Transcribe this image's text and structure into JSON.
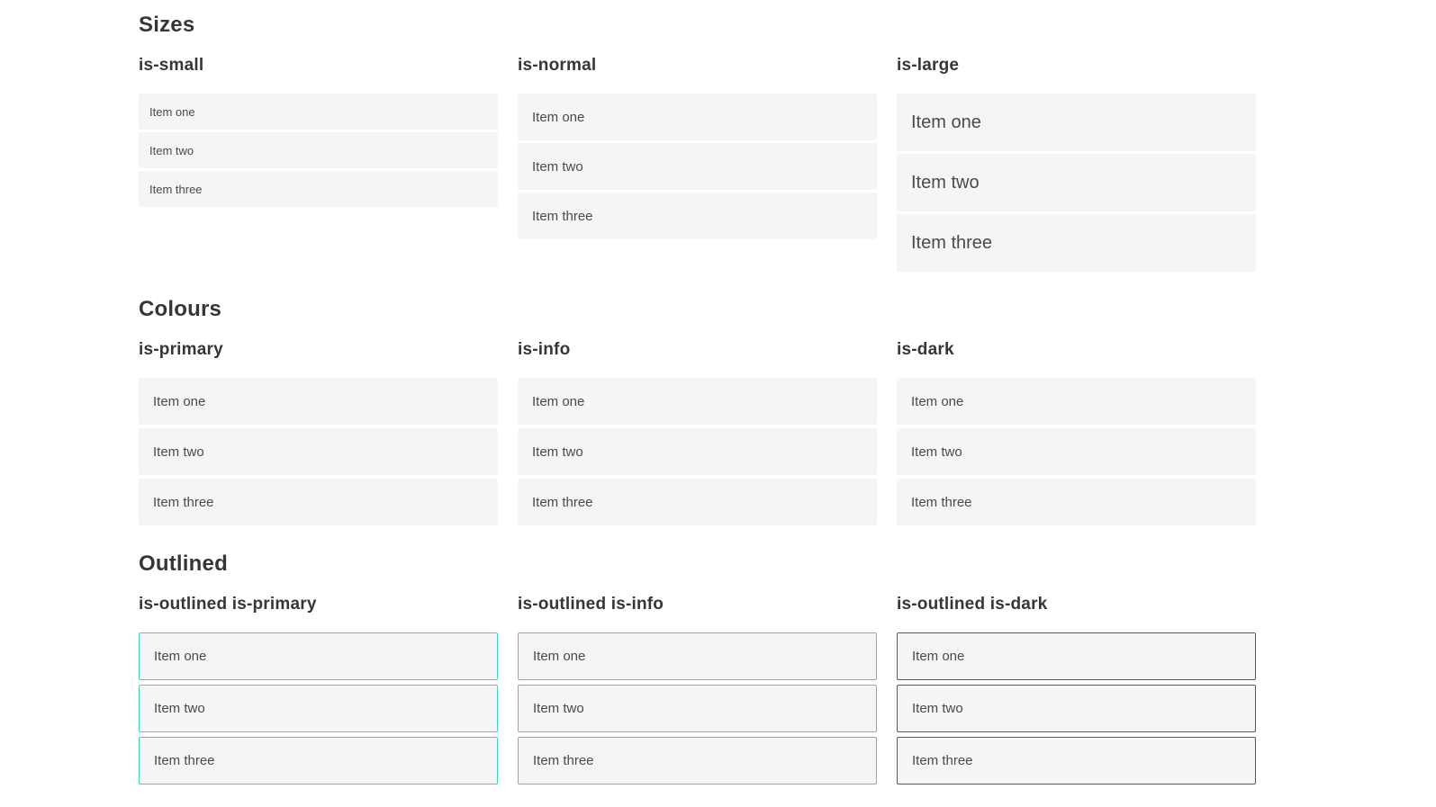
{
  "colors": {
    "primary": "#0bccb1",
    "info": "#3498db",
    "dark": "#363636",
    "item_background": "#f5f5f5",
    "item_text": "#4a4a4a",
    "heading_text": "#363636",
    "page_background": "#ffffff"
  },
  "sections": [
    {
      "title": "Sizes",
      "columns": [
        {
          "heading": "is-small",
          "items": [
            "Item one",
            "Item two",
            "Item three"
          ]
        },
        {
          "heading": "is-normal",
          "items": [
            "Item one",
            "Item two",
            "Item three"
          ]
        },
        {
          "heading": "is-large",
          "items": [
            "Item one",
            "Item two",
            "Item three"
          ]
        }
      ]
    },
    {
      "title": "Colours",
      "columns": [
        {
          "heading": "is-primary",
          "items": [
            "Item one",
            "Item two",
            "Item three"
          ]
        },
        {
          "heading": "is-info",
          "items": [
            "Item one",
            "Item two",
            "Item three"
          ]
        },
        {
          "heading": "is-dark",
          "items": [
            "Item one",
            "Item two",
            "Item three"
          ]
        }
      ]
    },
    {
      "title": "Outlined",
      "columns": [
        {
          "heading": "is-outlined is-primary",
          "items": [
            "Item one",
            "Item two",
            "Item three"
          ]
        },
        {
          "heading": "is-outlined is-info",
          "items": [
            "Item one",
            "Item two",
            "Item three"
          ]
        },
        {
          "heading": "is-outlined is-dark",
          "items": [
            "Item one",
            "Item two",
            "Item three"
          ]
        }
      ]
    }
  ]
}
